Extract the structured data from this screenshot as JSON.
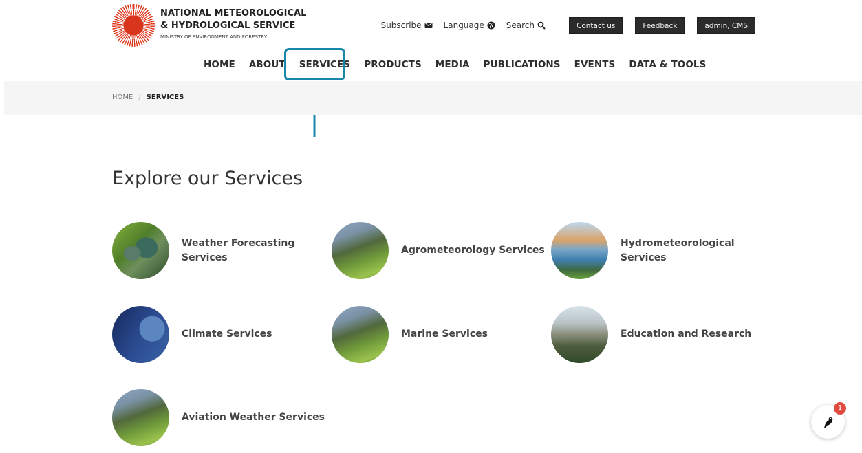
{
  "header": {
    "org_line1": "NATIONAL METEOROLOGICAL",
    "org_line2": "& HYDROLOGICAL SERVICE",
    "org_sub": "MINISTRY OF ENVIRONMENT AND FORESTRY",
    "links": {
      "subscribe": "Subscribe",
      "language": "Language",
      "search": "Search"
    },
    "buttons": {
      "contact": "Contact us",
      "feedback": "Feedback",
      "user": "admin, CMS"
    }
  },
  "nav": [
    "HOME",
    "ABOUT",
    "SERVICES",
    "PRODUCTS",
    "MEDIA",
    "PUBLICATIONS",
    "EVENTS",
    "DATA & TOOLS"
  ],
  "breadcrumb": {
    "home": "HOME",
    "separator": "/",
    "current": "SERVICES"
  },
  "main": {
    "title": "Explore our Services",
    "services": [
      {
        "label": "Weather Forecasting Services",
        "thumb": "river"
      },
      {
        "label": "Agrometeorology Services",
        "thumb": "mount"
      },
      {
        "label": "Hydrometeorological Services",
        "thumb": "coast"
      },
      {
        "label": "Climate Services",
        "thumb": "earth"
      },
      {
        "label": "Marine Services",
        "thumb": "mount"
      },
      {
        "label": "Education and Research",
        "thumb": "city"
      },
      {
        "label": "Aviation Weather Services",
        "thumb": "mount"
      }
    ]
  },
  "chat": {
    "badge": "1",
    "icon": "bird-icon"
  },
  "colors": {
    "highlight": "#1a86ac",
    "badge": "#e04a3f",
    "dark_button": "#2b2b2b"
  }
}
